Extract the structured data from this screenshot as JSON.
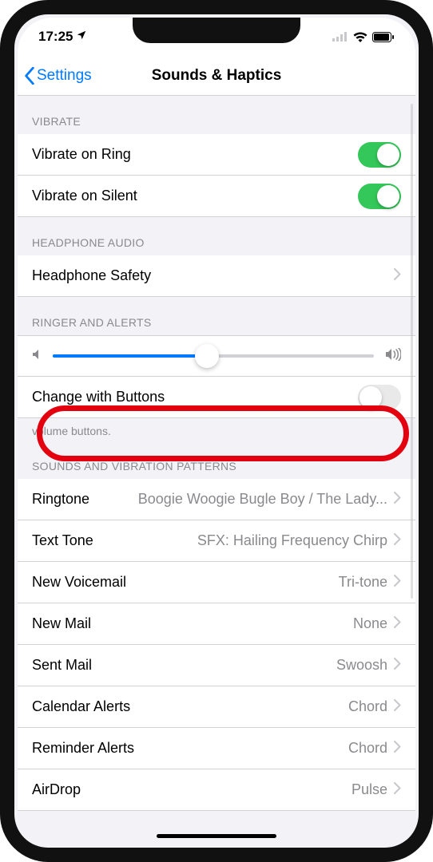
{
  "status": {
    "time": "17:25"
  },
  "nav": {
    "back": "Settings",
    "title": "Sounds & Haptics"
  },
  "sections": {
    "vibrate": {
      "header": "VIBRATE",
      "ring": {
        "label": "Vibrate on Ring",
        "on": true
      },
      "silent": {
        "label": "Vibrate on Silent",
        "on": true
      }
    },
    "headphone": {
      "header": "HEADPHONE AUDIO",
      "safety": {
        "label": "Headphone Safety"
      }
    },
    "ringer": {
      "header": "RINGER AND ALERTS",
      "slider_percent": 48,
      "changeButtons": {
        "label": "Change with Buttons",
        "on": false
      },
      "footer": "volume buttons."
    },
    "patterns": {
      "header": "SOUNDS AND VIBRATION PATTERNS",
      "items": [
        {
          "label": "Ringtone",
          "value": "Boogie Woogie Bugle Boy / The Lady..."
        },
        {
          "label": "Text Tone",
          "value": "SFX: Hailing Frequency Chirp"
        },
        {
          "label": "New Voicemail",
          "value": "Tri-tone"
        },
        {
          "label": "New Mail",
          "value": "None"
        },
        {
          "label": "Sent Mail",
          "value": "Swoosh"
        },
        {
          "label": "Calendar Alerts",
          "value": "Chord"
        },
        {
          "label": "Reminder Alerts",
          "value": "Chord"
        },
        {
          "label": "AirDrop",
          "value": "Pulse"
        }
      ]
    }
  }
}
